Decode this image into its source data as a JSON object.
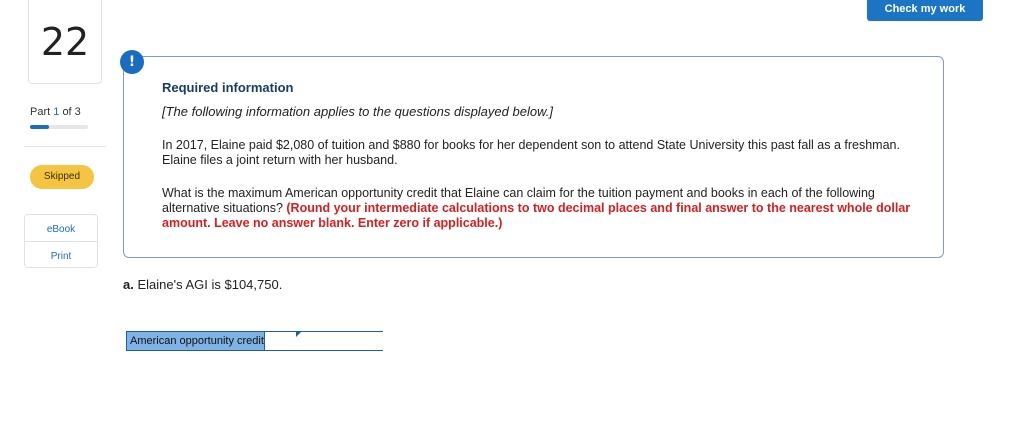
{
  "question_number": "22",
  "check_button_label": "Check my work",
  "part": {
    "label": "Part",
    "current": "1",
    "of_text": "of 3",
    "progress_fraction": 0.33
  },
  "status_badge": "Skipped",
  "resources": {
    "ebook": "eBook",
    "print": "Print"
  },
  "info": {
    "icon": "!",
    "title": "Required information",
    "subtitle": "[The following information applies to the questions displayed below.]",
    "paragraph1": "In 2017, Elaine paid $2,080 of tuition and $880 for books for her dependent son to attend State University this past fall as a freshman. Elaine files a joint return with her husband.",
    "paragraph2_plain": "What is the maximum American opportunity credit that Elaine can claim for the tuition payment and books in each of the following alternative situations? ",
    "paragraph2_red": "(Round your intermediate calculations to two decimal places and final answer to the nearest whole dollar amount. Leave no answer blank. Enter zero if applicable.)"
  },
  "question": {
    "letter": "a.",
    "text": "Elaine's AGI is $104,750."
  },
  "answer_row": {
    "label": "American opportunity credit",
    "value": ""
  },
  "colors": {
    "accent": "#1b75c4",
    "badge": "#f5c542",
    "emphasis": "#d81f1f",
    "answer_label_bg": "#7fb2e5"
  }
}
